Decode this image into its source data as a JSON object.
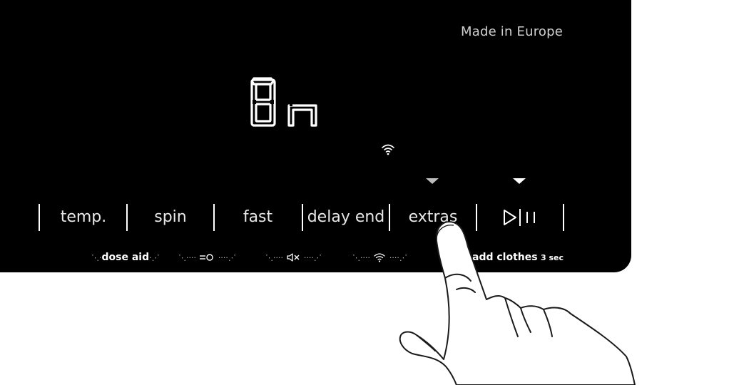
{
  "panel": {
    "brand_text": "Made in Europe",
    "display_text": "On",
    "buttons": [
      {
        "label": "temp."
      },
      {
        "label": "spin"
      },
      {
        "label": "fast"
      },
      {
        "label": "delay end"
      },
      {
        "label": "extras"
      },
      {
        "label": "start-pause-icon"
      }
    ],
    "sub_labels": {
      "dose_aid": "dose aid",
      "add_clothes": "add clothes",
      "add_clothes_duration": "3 sec"
    },
    "icons": {
      "wifi_status": "wifi-icon",
      "child_lock": "child-lock-icon",
      "mute": "mute-icon",
      "wifi_hold": "wifi-icon"
    },
    "colors": {
      "panel_bg": "#000000",
      "text": "#e8e8e8",
      "background": "#ffffff"
    }
  }
}
